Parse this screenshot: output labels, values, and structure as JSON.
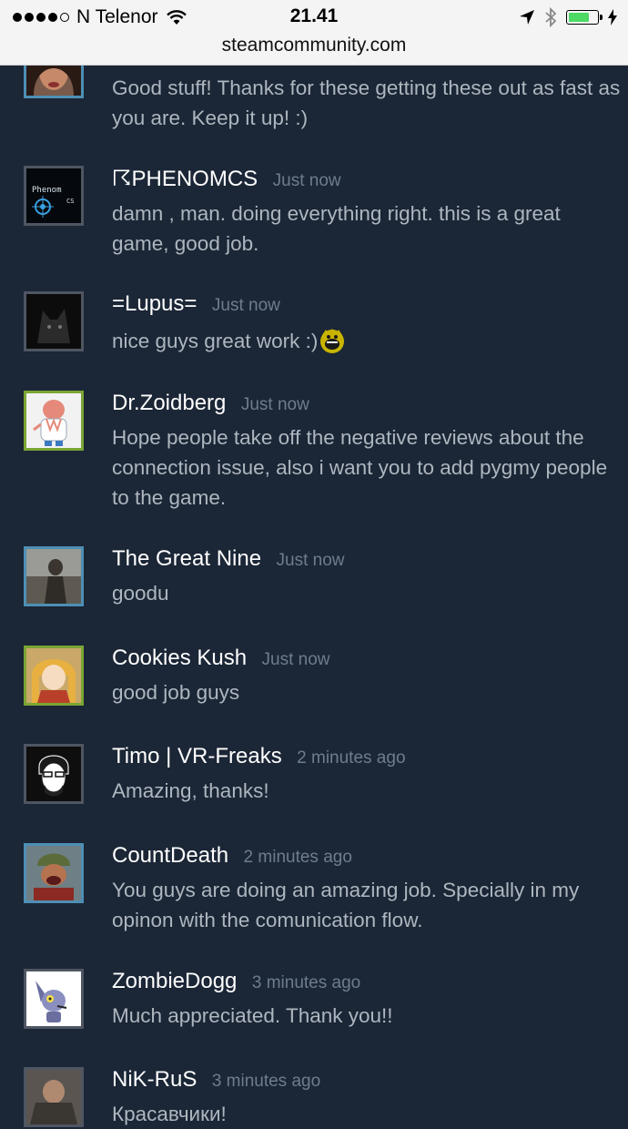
{
  "status_bar": {
    "carrier": "N Telenor",
    "time": "21.41",
    "url": "steamcommunity.com",
    "battery_level": 0.75
  },
  "comments": [
    {
      "name": "",
      "time": "",
      "text": "Good stuff! Thanks for these getting these out as fast as you are. Keep it up! :)"
    },
    {
      "name": "☈PHENOMCS",
      "time": "Just now",
      "text": "damn , man. doing everything right. this is a great game, good job."
    },
    {
      "name": "=Lupus=",
      "time": "Just now",
      "text": "nice guys great work :)"
    },
    {
      "name": "Dr.Zoidberg",
      "time": "Just now",
      "text": "Hope people take off the negative reviews about the connection issue, also i want you to add pygmy people to the game."
    },
    {
      "name": "The Great Nine",
      "time": "Just now",
      "text": "goodu"
    },
    {
      "name": "Cookies Kush",
      "time": "Just now",
      "text": "good job guys"
    },
    {
      "name": "Timo | VR-Freaks",
      "time": "2 minutes ago",
      "text": "Amazing, thanks!"
    },
    {
      "name": "CountDeath",
      "time": "2 minutes ago",
      "text": "You guys are doing an amazing job. Specially in my opinon with the comunication flow."
    },
    {
      "name": "ZombieDogg",
      "time": "3 minutes ago",
      "text": "Much appreciated. Thank you!!"
    },
    {
      "name": "NiK-RuS",
      "time": "3 minutes ago",
      "text": "Красавчики!"
    }
  ],
  "avatar_texts": {
    "phenom_line1": "Phenom",
    "phenom_line2": "CS"
  }
}
